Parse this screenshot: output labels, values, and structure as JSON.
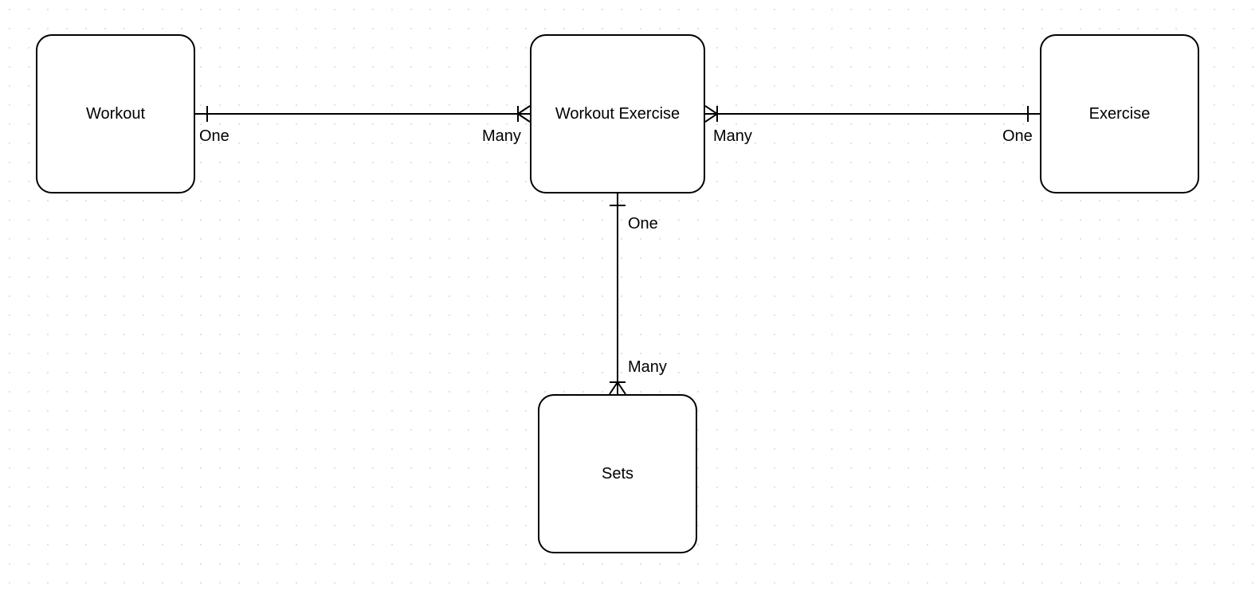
{
  "entities": {
    "workout": {
      "label": "Workout"
    },
    "workout_exercise": {
      "label": "Workout Exercise"
    },
    "exercise": {
      "label": "Exercise"
    },
    "sets": {
      "label": "Sets"
    }
  },
  "relationships": {
    "workout_side": "One",
    "we_left_side": "Many",
    "we_right_side": "Many",
    "exercise_side": "One",
    "we_bottom_side": "One",
    "sets_side": "Many"
  }
}
